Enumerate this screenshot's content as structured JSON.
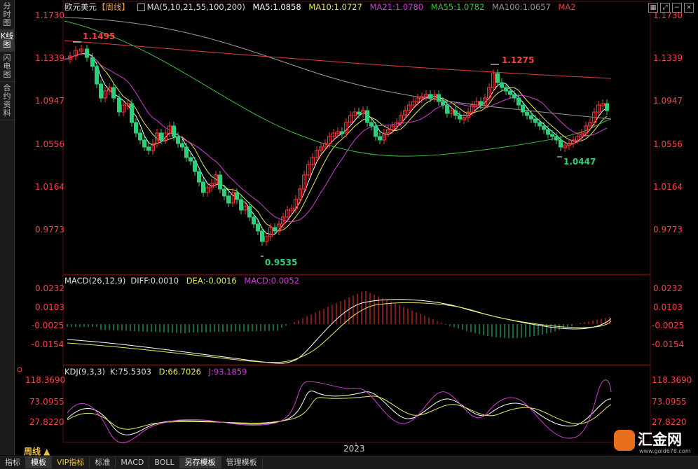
{
  "left_tabs": [
    "分时图",
    "K线图",
    "闪电图",
    "合约资料"
  ],
  "main": {
    "symbol": "欧元美元",
    "period": "【周线】",
    "ma_title": "MA(5,10,21,55,100,200)",
    "ma5": "MA5:1.0858",
    "ma10": "MA10:1.0727",
    "ma21": "MA21:1.0780",
    "ma55": "MA55:1.0782",
    "ma100": "MA100:1.0657",
    "ma2": "MA2",
    "price_labels": [
      "1.1730",
      "1.1339",
      "1.0947",
      "1.0556",
      "1.0164",
      "0.9773"
    ],
    "annotations": {
      "high1": "1.1495",
      "high2": "1.1275",
      "low1": "0.9535",
      "low2": "1.0447"
    }
  },
  "macd": {
    "title": "MACD(26,12,9)",
    "diff": "DIFF:0.0010",
    "dea": "DEA:-0.0016",
    "macd": "MACD:0.0052",
    "labels": [
      "0.0232",
      "0.0103",
      "-0.0025",
      "-0.0154"
    ]
  },
  "kdj": {
    "title": "KDJ(9,3,3)",
    "k": "K:75.5303",
    "d": "D:66.7026",
    "j": "J:93.1859",
    "labels": [
      "118.3690",
      "73.0955",
      "27.8220"
    ]
  },
  "x_axis": {
    "year_label": "2023"
  },
  "period_selector": "周线 ▲",
  "bottom_tabs": [
    "指标",
    "模板",
    "VIP指标",
    "标准",
    "MACD",
    "BOLL",
    "另存模板",
    "管理模板"
  ],
  "logo": {
    "text": "汇金网",
    "sub": "www.gold678.com"
  },
  "colors": {
    "up": "#ff3333",
    "down": "#2ad07a",
    "ma5": "#ffffff",
    "ma10": "#e8e85a",
    "ma21": "#d040d0",
    "ma55": "#40c040",
    "ma100": "#999999",
    "ma2": "#e04040",
    "axis": "#ff4040"
  }
}
